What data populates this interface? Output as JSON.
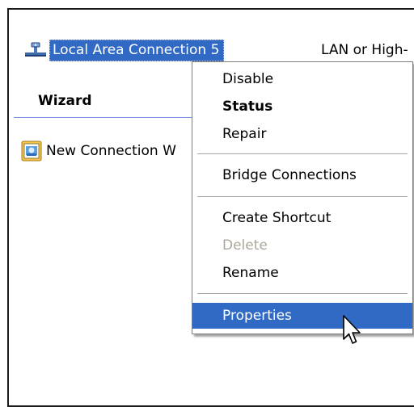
{
  "connection": {
    "name": "Local Area Connection 5",
    "type": "LAN or High-",
    "icon": "network-connection-icon"
  },
  "group": {
    "header": "Wizard",
    "wizard_item": "New Connection W",
    "wizard_icon": "new-connection-wizard-icon"
  },
  "context_menu": {
    "disable": "Disable",
    "status": "Status",
    "repair": "Repair",
    "bridge": "Bridge Connections",
    "create_shortcut": "Create Shortcut",
    "delete": "Delete",
    "rename": "Rename",
    "properties": "Properties"
  },
  "colors": {
    "selection": "#316ac5",
    "disabled_text": "#aca899"
  },
  "cursor_icon": "mouse-pointer-icon"
}
